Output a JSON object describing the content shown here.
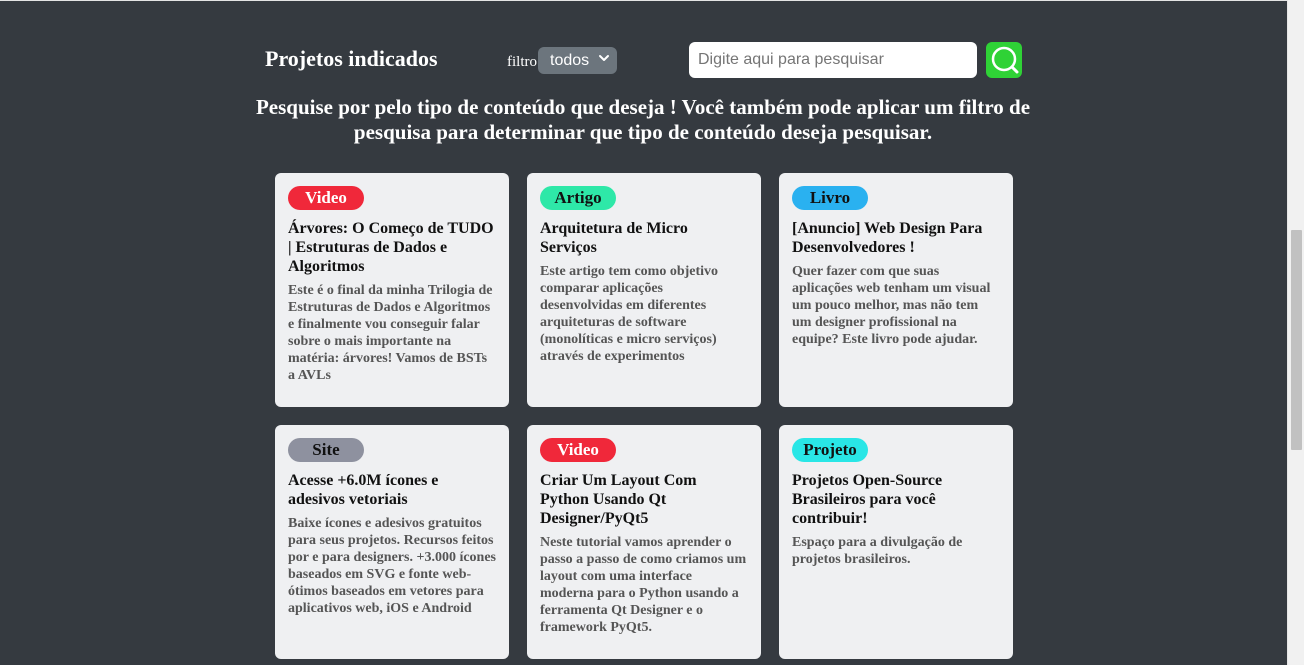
{
  "header": {
    "title": "Projetos indicados",
    "filter_label": "filtro",
    "filter_selected": "todos",
    "search_placeholder": "Digite aqui para pesquisar"
  },
  "intro": "Pesquise por pelo tipo de conteúdo que deseja ! Você também pode aplicar um filtro de pesquisa para determinar que tipo de conteúdo deseja pesquisar.",
  "colors": {
    "background": "#353a40",
    "card": "#eff0f2",
    "search_button": "#2fd236",
    "badge_video": "#f0283a",
    "badge_artigo": "#2ee8a8",
    "badge_livro": "#2ab1f0",
    "badge_site": "#8e919f",
    "badge_projeto": "#29e6e6"
  },
  "cards": [
    {
      "badge": "Video",
      "title": "Árvores: O Começo de TUDO | Estruturas de Dados e Algoritmos",
      "description": "Este é o final da minha Trilogia de Estruturas de Dados e Algoritmos e finalmente vou conseguir falar sobre o mais importante na matéria: árvores! Vamos de BSTs a AVLs"
    },
    {
      "badge": "Artigo",
      "title": "Arquitetura de Micro Serviços",
      "description": "Este artigo tem como objetivo comparar aplicações desenvolvidas em diferentes arquiteturas de software (monolíticas e micro serviços) através de experimentos"
    },
    {
      "badge": "Livro",
      "title": "[Anuncio] Web Design Para Desenvolvedores !",
      "description": "Quer fazer com que suas aplicações web tenham um visual um pouco melhor, mas não tem um designer profissional na equipe? Este livro pode ajudar."
    },
    {
      "badge": "Site",
      "title": "Acesse +6.0M ícones e adesivos vetoriais",
      "description": "Baixe ícones e adesivos gratuitos para seus projetos. Recursos feitos por e para designers. +3.000 ícones baseados em SVG e fonte web-ótimos baseados em vetores para aplicativos web, iOS e Android"
    },
    {
      "badge": "Video",
      "title": "Criar Um Layout Com Python Usando Qt Designer/PyQt5",
      "description": "Neste tutorial vamos aprender o passo a passo de como criamos um layout com uma interface moderna para o Python usando a ferramenta Qt Designer e o framework PyQt5."
    },
    {
      "badge": "Projeto",
      "title": "Projetos Open-Source Brasileiros para você contribuir!",
      "description": "Espaço para a divulgação de projetos brasileiros."
    }
  ]
}
